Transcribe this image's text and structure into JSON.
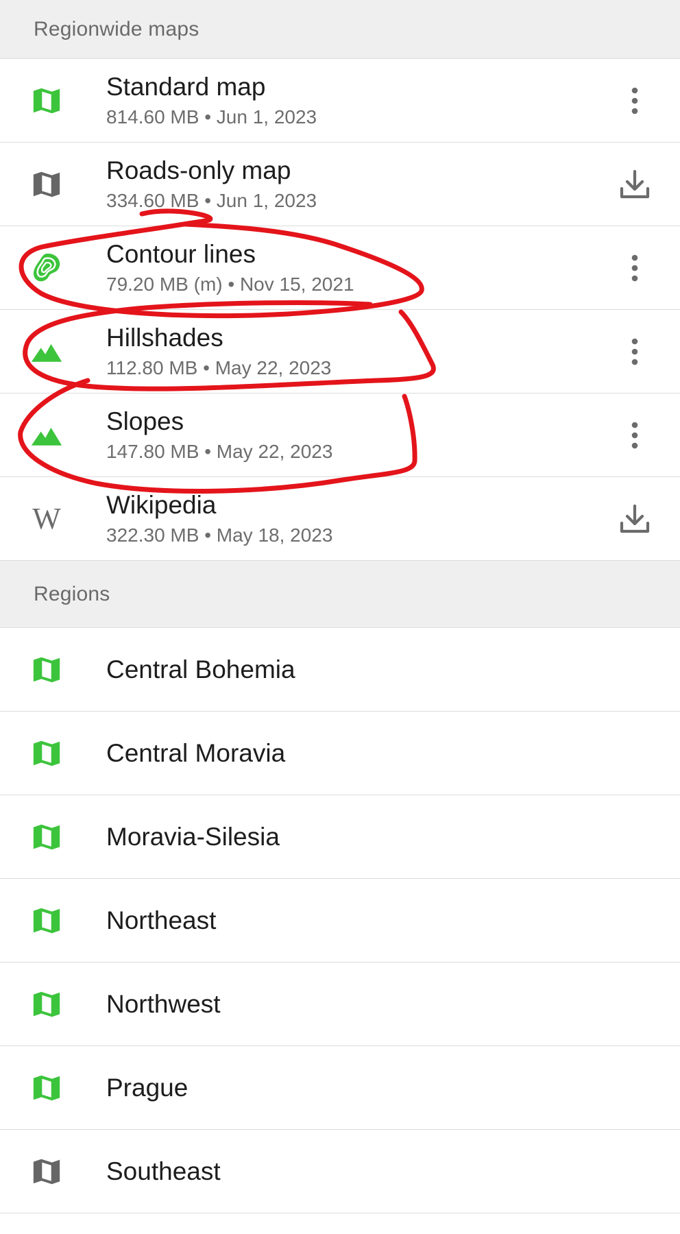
{
  "regionwide": {
    "header": "Regionwide maps",
    "items": [
      {
        "title": "Standard map",
        "meta": "814.60 MB • Jun 1, 2023",
        "icon": "map-icon",
        "icon_color": "#3cc43c",
        "action": "more-vert-icon"
      },
      {
        "title": "Roads-only map",
        "meta": "334.60 MB • Jun 1, 2023",
        "icon": "map-icon",
        "icon_color": "#666666",
        "action": "download-icon"
      },
      {
        "title": "Contour lines",
        "meta": "79.20 MB (m) • Nov 15, 2021",
        "icon": "contour-lines-icon",
        "icon_color": "#3cc43c",
        "action": "more-vert-icon"
      },
      {
        "title": "Hillshades",
        "meta": "112.80 MB • May 22, 2023",
        "icon": "mountains-icon",
        "icon_color": "#3cc43c",
        "action": "more-vert-icon"
      },
      {
        "title": "Slopes",
        "meta": "147.80 MB • May 22, 2023",
        "icon": "mountains-icon",
        "icon_color": "#3cc43c",
        "action": "more-vert-icon"
      },
      {
        "title": "Wikipedia",
        "meta": "322.30 MB • May 18, 2023",
        "icon": "wikipedia-icon",
        "icon_glyph": "W",
        "icon_color": "#666666",
        "action": "download-icon"
      }
    ]
  },
  "regions": {
    "header": "Regions",
    "items": [
      {
        "title": "Central Bohemia",
        "icon": "map-icon",
        "icon_color": "#3cc43c"
      },
      {
        "title": "Central Moravia",
        "icon": "map-icon",
        "icon_color": "#3cc43c"
      },
      {
        "title": "Moravia-Silesia",
        "icon": "map-icon",
        "icon_color": "#3cc43c"
      },
      {
        "title": "Northeast",
        "icon": "map-icon",
        "icon_color": "#3cc43c"
      },
      {
        "title": "Northwest",
        "icon": "map-icon",
        "icon_color": "#3cc43c"
      },
      {
        "title": "Prague",
        "icon": "map-icon",
        "icon_color": "#3cc43c"
      },
      {
        "title": "Southeast",
        "icon": "map-icon",
        "icon_color": "#666666"
      }
    ]
  },
  "colors": {
    "accent_green": "#3cc43c",
    "icon_gray": "#666666",
    "annotation_red": "#e4141b"
  }
}
